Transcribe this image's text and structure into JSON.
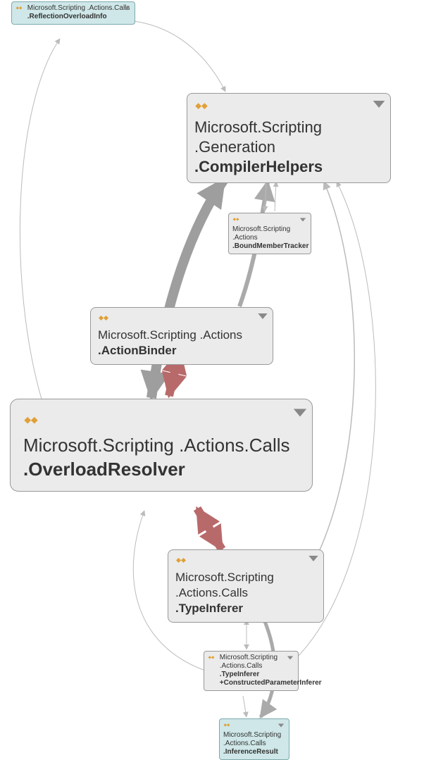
{
  "nodes": {
    "reflectionOverloadInfo": {
      "ns": "Microsoft.Scripting .Actions.Calls",
      "cls": ".ReflectionOverloadInfo"
    },
    "compilerHelpers": {
      "ns": "Microsoft.Scripting .Generation",
      "cls": ".CompilerHelpers"
    },
    "boundMemberTracker": {
      "ns": "Microsoft.Scripting .Actions",
      "cls": ".BoundMemberTracker"
    },
    "actionBinder": {
      "ns": "Microsoft.Scripting .Actions",
      "cls": ".ActionBinder"
    },
    "overloadResolver": {
      "ns": "Microsoft.Scripting .Actions.Calls",
      "cls": ".OverloadResolver"
    },
    "typeInferer": {
      "ns": "Microsoft.Scripting .Actions.Calls",
      "cls": ".TypeInferer"
    },
    "constructedParameterInferer": {
      "ns": "Microsoft.Scripting .Actions.Calls",
      "cls": ".TypeInferer +ConstructedParameterInferer"
    },
    "inferenceResult": {
      "ns": "Microsoft.Scripting .Actions.Calls",
      "cls": ".InferenceResult"
    }
  },
  "chart_data": {
    "type": "diagram-dependency-graph",
    "nodes": [
      {
        "id": "ReflectionOverloadInfo",
        "namespace": "Microsoft.Scripting.Actions.Calls",
        "highlight": "teal"
      },
      {
        "id": "CompilerHelpers",
        "namespace": "Microsoft.Scripting.Generation"
      },
      {
        "id": "BoundMemberTracker",
        "namespace": "Microsoft.Scripting.Actions"
      },
      {
        "id": "ActionBinder",
        "namespace": "Microsoft.Scripting.Actions"
      },
      {
        "id": "OverloadResolver",
        "namespace": "Microsoft.Scripting.Actions.Calls"
      },
      {
        "id": "TypeInferer",
        "namespace": "Microsoft.Scripting.Actions.Calls"
      },
      {
        "id": "TypeInferer+ConstructedParameterInferer",
        "namespace": "Microsoft.Scripting.Actions.Calls"
      },
      {
        "id": "InferenceResult",
        "namespace": "Microsoft.Scripting.Actions.Calls",
        "highlight": "teal"
      }
    ],
    "edges": [
      {
        "from": "ReflectionOverloadInfo",
        "to": "CompilerHelpers",
        "weight": "thin"
      },
      {
        "from": "CompilerHelpers",
        "to": "ReflectionOverloadInfo",
        "weight": "thin"
      },
      {
        "from": "CompilerHelpers",
        "to": "BoundMemberTracker",
        "weight": "thin"
      },
      {
        "from": "BoundMemberTracker",
        "to": "CompilerHelpers",
        "weight": "thin"
      },
      {
        "from": "CompilerHelpers",
        "to": "OverloadResolver",
        "weight": "thick",
        "bidirectional": true
      },
      {
        "from": "ActionBinder",
        "to": "CompilerHelpers",
        "weight": "medium"
      },
      {
        "from": "ActionBinder",
        "to": "OverloadResolver",
        "weight": "thick",
        "color": "red",
        "bidirectional": true
      },
      {
        "from": "OverloadResolver",
        "to": "ReflectionOverloadInfo",
        "weight": "thin"
      },
      {
        "from": "OverloadResolver",
        "to": "TypeInferer",
        "weight": "thick",
        "color": "red",
        "bidirectional": true
      },
      {
        "from": "TypeInferer",
        "to": "CompilerHelpers",
        "weight": "thin"
      },
      {
        "from": "TypeInferer",
        "to": "TypeInferer+ConstructedParameterInferer",
        "weight": "thin",
        "bidirectional": true
      },
      {
        "from": "TypeInferer",
        "to": "InferenceResult",
        "weight": "medium"
      },
      {
        "from": "TypeInferer+ConstructedParameterInferer",
        "to": "CompilerHelpers",
        "weight": "thin"
      },
      {
        "from": "TypeInferer+ConstructedParameterInferer",
        "to": "OverloadResolver",
        "weight": "thin"
      },
      {
        "from": "TypeInferer+ConstructedParameterInferer",
        "to": "InferenceResult",
        "weight": "thin"
      }
    ]
  }
}
